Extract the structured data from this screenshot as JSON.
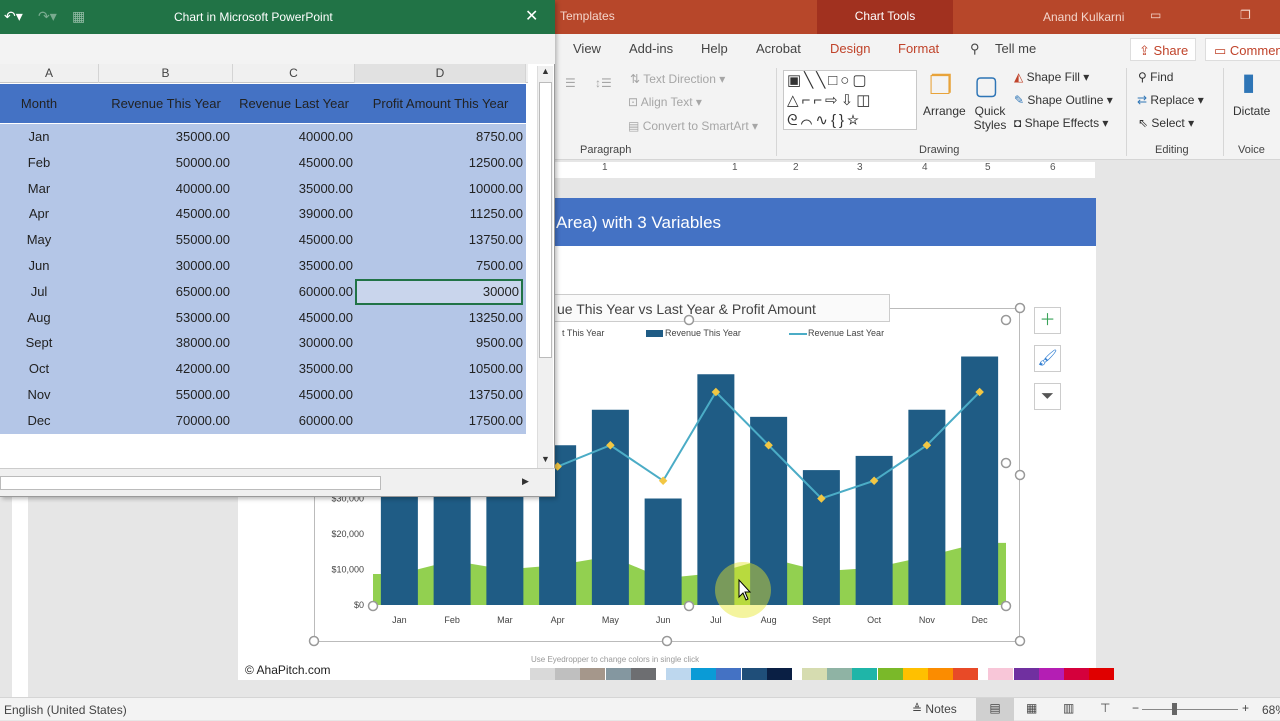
{
  "powerpoint": {
    "title_left": "Templates",
    "chart_tools": "Chart Tools",
    "user": "Anand Kulkarni",
    "tabs": [
      "View",
      "Add-ins",
      "Help",
      "Acrobat",
      "Design",
      "Format"
    ],
    "tell_me": "Tell me",
    "share": "Share",
    "comments": "Commen",
    "ribbon": {
      "text_direction": "Text Direction",
      "align_text": "Align Text",
      "convert_smartart": "Convert to SmartArt",
      "paragraph": "Paragraph",
      "arrange": "Arrange",
      "quick_styles": "Quick Styles",
      "shape_fill": "Shape Fill",
      "shape_outline": "Shape Outline",
      "shape_effects": "Shape Effects",
      "drawing": "Drawing",
      "find": "Find",
      "replace": "Replace",
      "select": "Select",
      "editing": "Editing",
      "dictate": "Dictate",
      "voice": "Voice"
    },
    "ruler": [
      "1",
      "1",
      "2",
      "3",
      "4",
      "5",
      "6"
    ],
    "slide_title": "Area) with 3 Variables",
    "copyright": "© AhaPitch.com",
    "eyedropper_hint": "Use Eyedropper to change colors in single click",
    "palette": [
      "#d9d9d9",
      "#bfbfbf",
      "#a5978b",
      "#8497a0",
      "#6d6e71",
      "#bdd7ee",
      "#0a9bd6",
      "#4472c4",
      "#1f4e79",
      "#0a1f44",
      "#d6dcb0",
      "#8fb3a4",
      "#1fb5a8",
      "#7ab929",
      "#ffc000",
      "#fb8c00",
      "#e84a27",
      "#f8c6d8",
      "#7030a0",
      "#b41eb4",
      "#d5003c",
      "#e00000"
    ],
    "status": {
      "language": "English (United States)",
      "notes": "Notes",
      "zoom": "68%"
    }
  },
  "excel": {
    "title": "Chart in Microsoft PowerPoint",
    "columns": [
      "A",
      "B",
      "C",
      "D"
    ],
    "headers": [
      "Month",
      "Revenue This Year",
      "Revenue Last Year",
      "Profit Amount This Year"
    ],
    "rows": [
      [
        "Jan",
        "35000.00",
        "40000.00",
        "8750.00"
      ],
      [
        "Feb",
        "50000.00",
        "45000.00",
        "12500.00"
      ],
      [
        "Mar",
        "40000.00",
        "35000.00",
        "10000.00"
      ],
      [
        "Apr",
        "45000.00",
        "39000.00",
        "11250.00"
      ],
      [
        "May",
        "55000.00",
        "45000.00",
        "13750.00"
      ],
      [
        "Jun",
        "30000.00",
        "35000.00",
        "7500.00"
      ],
      [
        "Jul",
        "65000.00",
        "60000.00",
        "30000"
      ],
      [
        "Aug",
        "53000.00",
        "45000.00",
        "13250.00"
      ],
      [
        "Sept",
        "38000.00",
        "30000.00",
        "9500.00"
      ],
      [
        "Oct",
        "42000.00",
        "35000.00",
        "10500.00"
      ],
      [
        "Nov",
        "55000.00",
        "45000.00",
        "13750.00"
      ],
      [
        "Dec",
        "70000.00",
        "60000.00",
        "17500.00"
      ]
    ],
    "selected_cell": "D8"
  },
  "chart_data": {
    "type": "bar",
    "title": "ue This Year vs Last Year & Profit Amount",
    "legend": [
      "t This Year",
      "Revenue This Year",
      "Revenue Last Year"
    ],
    "categories": [
      "Jan",
      "Feb",
      "Mar",
      "Apr",
      "May",
      "Jun",
      "Jul",
      "Aug",
      "Sept",
      "Oct",
      "Nov",
      "Dec"
    ],
    "yticks": [
      "$0",
      "$10,000",
      "$20,000",
      "$30,000"
    ],
    "ylim": [
      0,
      70000
    ],
    "series": [
      {
        "name": "Revenue This Year",
        "type": "bar",
        "color": "#1f5c85",
        "values": [
          35000,
          50000,
          40000,
          45000,
          55000,
          30000,
          65000,
          53000,
          38000,
          42000,
          55000,
          70000
        ]
      },
      {
        "name": "Revenue Last Year",
        "type": "line",
        "color": "#4bacc6",
        "marker": "#f2c744",
        "values": [
          40000,
          45000,
          35000,
          39000,
          45000,
          35000,
          60000,
          45000,
          30000,
          35000,
          45000,
          60000
        ]
      },
      {
        "type": "area",
        "color": "#92d050",
        "values": [
          8750,
          12500,
          10000,
          11250,
          13750,
          7500,
          9000,
          13250,
          9500,
          10500,
          13750,
          17500
        ]
      }
    ]
  }
}
